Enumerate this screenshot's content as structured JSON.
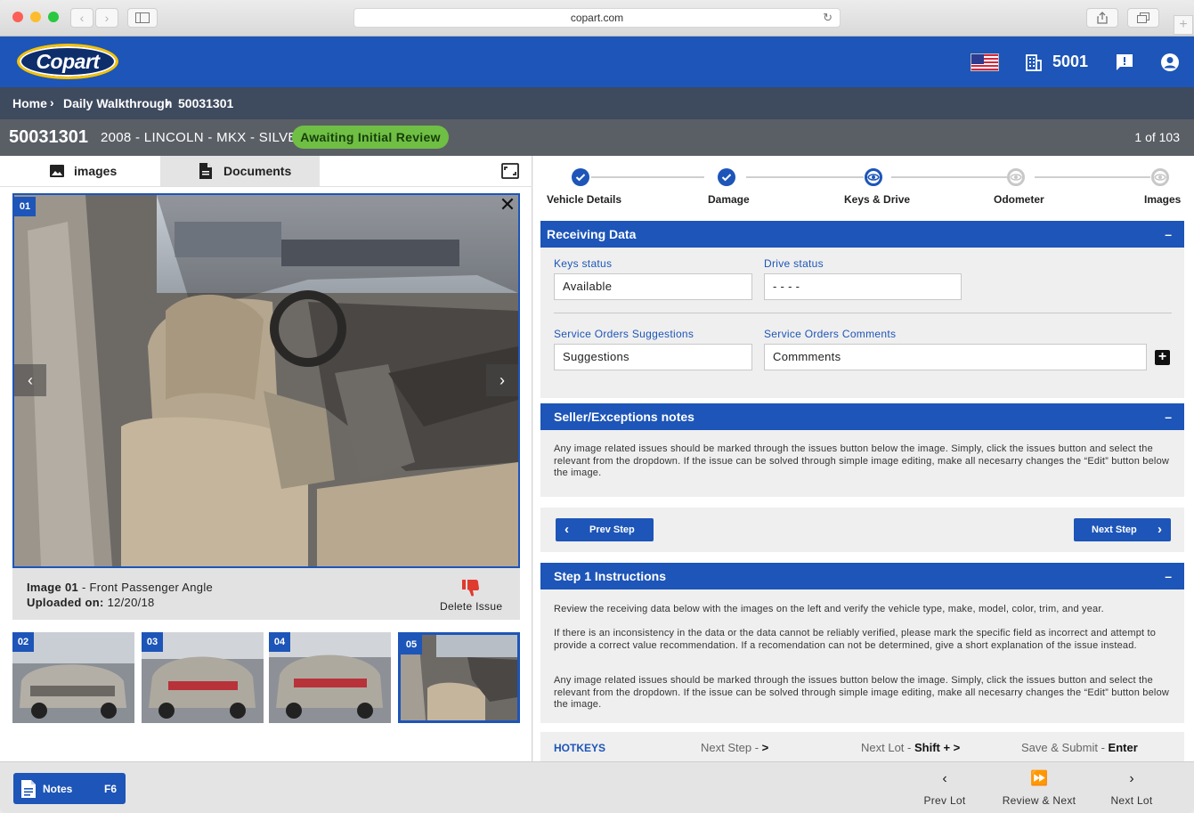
{
  "browser": {
    "url": "copart.com",
    "back_glyph": "‹",
    "forward_glyph": "›",
    "reload_glyph": "↻",
    "new_tab_glyph": "+"
  },
  "header": {
    "logo_text": "Copart",
    "yard_number": "5001",
    "accent": "#1d55b8"
  },
  "breadcrumb": {
    "items": [
      "Home",
      "Daily Walkthrough",
      "50031301"
    ],
    "separator": "›"
  },
  "lot": {
    "number": "50031301",
    "description": "2008 - LINCOLN - MKX - SILVER",
    "status": "Awaiting Initial Review",
    "status_color": "#6fbf44",
    "position": "1 of 103"
  },
  "left_tabs": {
    "images": "images",
    "documents": "Documents"
  },
  "viewer": {
    "badge": "01",
    "close_glyph": "✕",
    "prev_glyph": "‹",
    "next_glyph": "›",
    "image_label": "Image 01",
    "image_desc": " - Front Passenger Angle",
    "uploaded_label": "Uploaded on:",
    "uploaded_value": " 12/20/18",
    "delete_label": "Delete Issue"
  },
  "thumbnails": [
    {
      "badge": "02"
    },
    {
      "badge": "03"
    },
    {
      "badge": "04"
    },
    {
      "badge": "05"
    }
  ],
  "steps": [
    {
      "label": "Vehicle Details",
      "state": "done"
    },
    {
      "label": "Damage",
      "state": "done"
    },
    {
      "label": "Keys & Drive",
      "state": "current"
    },
    {
      "label": "Odometer",
      "state": "todo"
    },
    {
      "label": "Images",
      "state": "todo"
    }
  ],
  "receiving": {
    "title": "Receiving Data",
    "collapse_glyph": "–",
    "keys_status_label": "Keys status",
    "keys_status_value": "Available",
    "drive_status_label": "Drive status",
    "drive_status_value": "- - - -",
    "suggestions_label": "Service Orders Suggestions",
    "suggestions_value": "Suggestions",
    "comments_label": "Service Orders Comments",
    "comments_value": "Commments",
    "add_glyph": "+"
  },
  "seller": {
    "title": "Seller/Exceptions notes",
    "collapse_glyph": "–",
    "text": "Any image related issues should be marked through the issues button below the image. Simply, click the issues button and select the relevant from the dropdown. If the issue can be solved through simple image editing, make all necesarry changes the “Edit” button below the image."
  },
  "nav": {
    "prev_step": "Prev Step",
    "next_step": "Next Step",
    "prev_glyph": "‹",
    "next_glyph": "›"
  },
  "instructions": {
    "title": "Step 1 Instructions",
    "collapse_glyph": "–",
    "p1": "Review the receiving data below with the images on the left and verify the vehicle type, make, model, color, trim, and year.",
    "p2": "If there is an inconsistency in the data or the data cannot be reliably verified, please mark the specific field as incorrect and attempt to provide a correct value recommendation. If a recomendation can not be determined, give a short explanation of the issue instead.",
    "p3": "Any image related issues should be marked through the issues button below the image. Simply, click the issues button and select the relevant from the dropdown. If the issue can be solved through simple image editing, make all necesarry changes the “Edit” button below the image."
  },
  "hotkeys": {
    "title": "HOTKEYS",
    "items": [
      {
        "label": "Next Step - ",
        "key": ">"
      },
      {
        "label": "Next Lot - ",
        "key": "Shift + >"
      },
      {
        "label": "Save & Submit - ",
        "key": "Enter"
      }
    ]
  },
  "footer": {
    "notes_label": "Notes",
    "notes_key": "F6",
    "prev_lot": "Prev Lot",
    "review_next": "Review & Next",
    "next_lot": "Next Lot",
    "prev_glyph": "‹",
    "review_glyph": "⏩",
    "next_glyph": "›"
  }
}
